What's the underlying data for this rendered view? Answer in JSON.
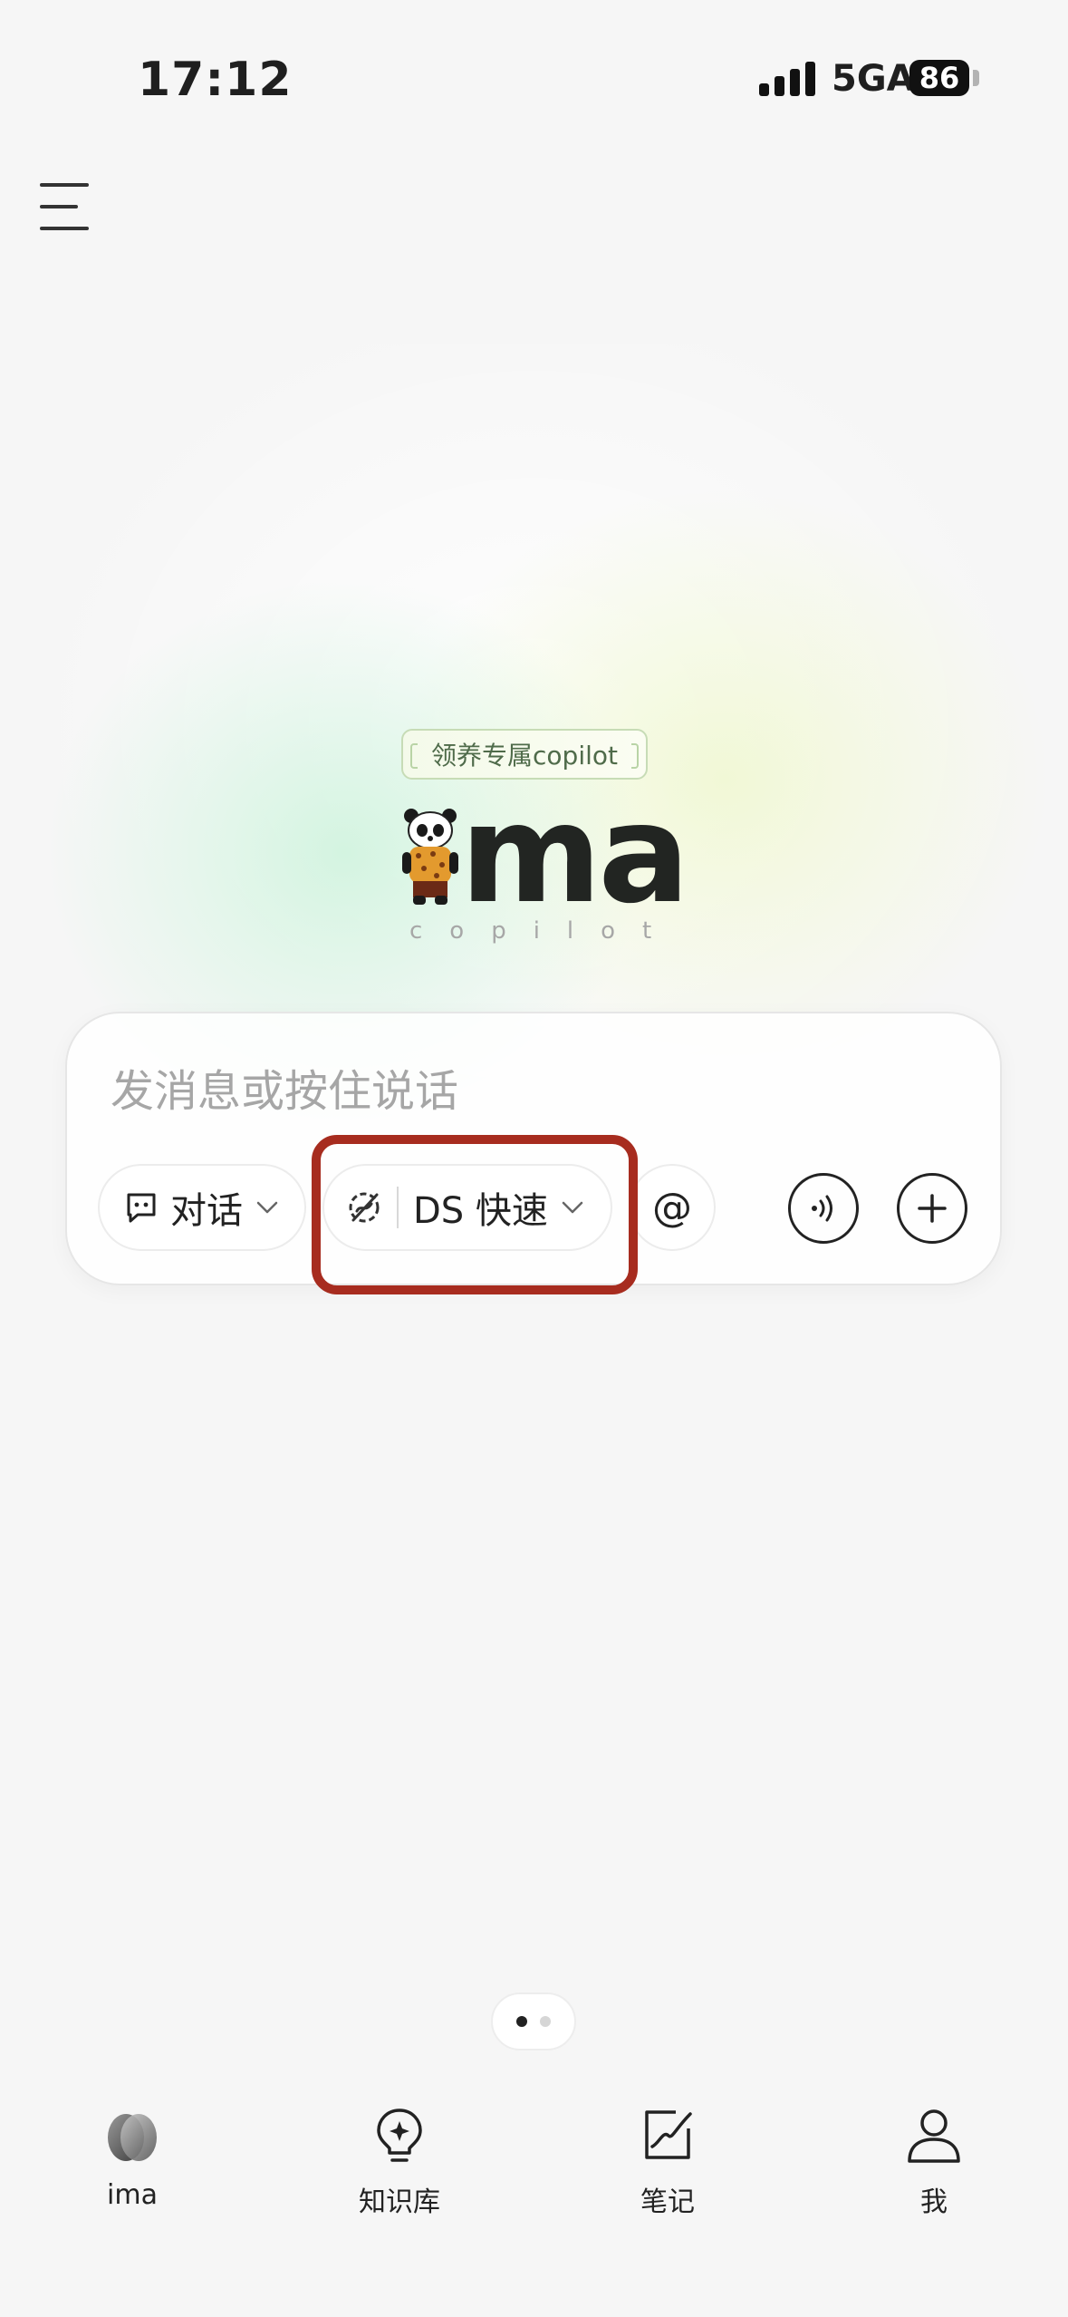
{
  "status_bar": {
    "time": "17:12",
    "network": "5GA",
    "battery": "86"
  },
  "logo": {
    "badge_text": "领养专属copilot",
    "wordmark": "ma",
    "subtitle": "copilot"
  },
  "input_card": {
    "placeholder": "发消息或按住说话",
    "mode_label": "对话",
    "model_label": "DS 快速",
    "mention_label": "@"
  },
  "pagination": {
    "total": 2,
    "active": 1
  },
  "tab_bar": {
    "items": [
      {
        "label": "ima",
        "icon": "ima-logo-icon"
      },
      {
        "label": "知识库",
        "icon": "lightbulb-icon"
      },
      {
        "label": "笔记",
        "icon": "note-edit-icon"
      },
      {
        "label": "我",
        "icon": "person-icon"
      }
    ]
  },
  "colors": {
    "highlight": "#a72c1f",
    "text": "#222222",
    "placeholder": "#a6a6a6"
  }
}
